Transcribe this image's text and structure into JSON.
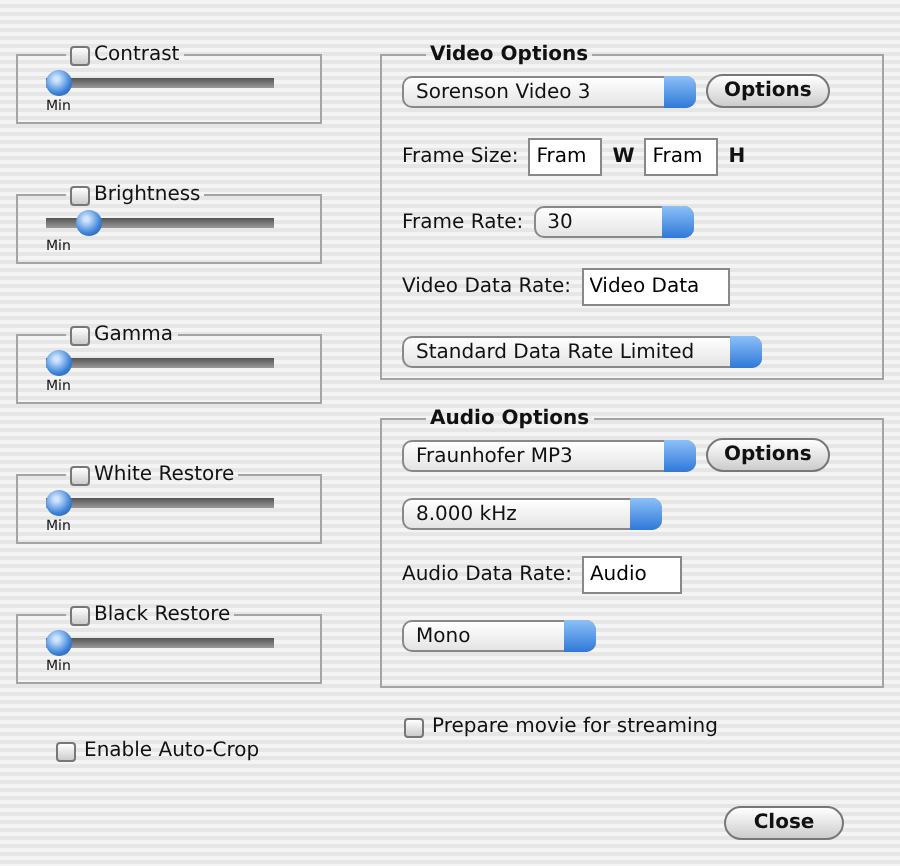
{
  "adjustments": [
    {
      "label": "Contrast",
      "checked": false,
      "level": 0,
      "min_label": "Min"
    },
    {
      "label": "Brightness",
      "checked": false,
      "level": 0.15,
      "min_label": "Min"
    },
    {
      "label": "Gamma",
      "checked": false,
      "level": 0,
      "min_label": "Min"
    },
    {
      "label": "White Restore",
      "checked": false,
      "level": 0,
      "min_label": "Min"
    },
    {
      "label": "Black Restore",
      "checked": false,
      "level": 0,
      "min_label": "Min"
    }
  ],
  "auto_crop": {
    "label": "Enable Auto-Crop",
    "checked": false
  },
  "video_options": {
    "title": "Video Options",
    "codec": "Sorenson Video 3",
    "options_button": "Options",
    "frame_size_label": "Frame Size:",
    "width": "Fram",
    "width_unit": "W",
    "height": "Fram",
    "height_unit": "H",
    "frame_rate_label": "Frame Rate:",
    "frame_rate": "30",
    "data_rate_label": "Video Data Rate:",
    "data_rate": "Video Data",
    "data_rate_mode": "Standard Data Rate Limited"
  },
  "audio_options": {
    "title": "Audio Options",
    "codec": "Fraunhofer MP3",
    "options_button": "Options",
    "sample_rate": "8.000 kHz",
    "data_rate_label": "Audio Data Rate:",
    "data_rate": "Audio",
    "channels": "Mono"
  },
  "streaming": {
    "label": "Prepare movie for streaming",
    "checked": false
  },
  "close_button": "Close"
}
